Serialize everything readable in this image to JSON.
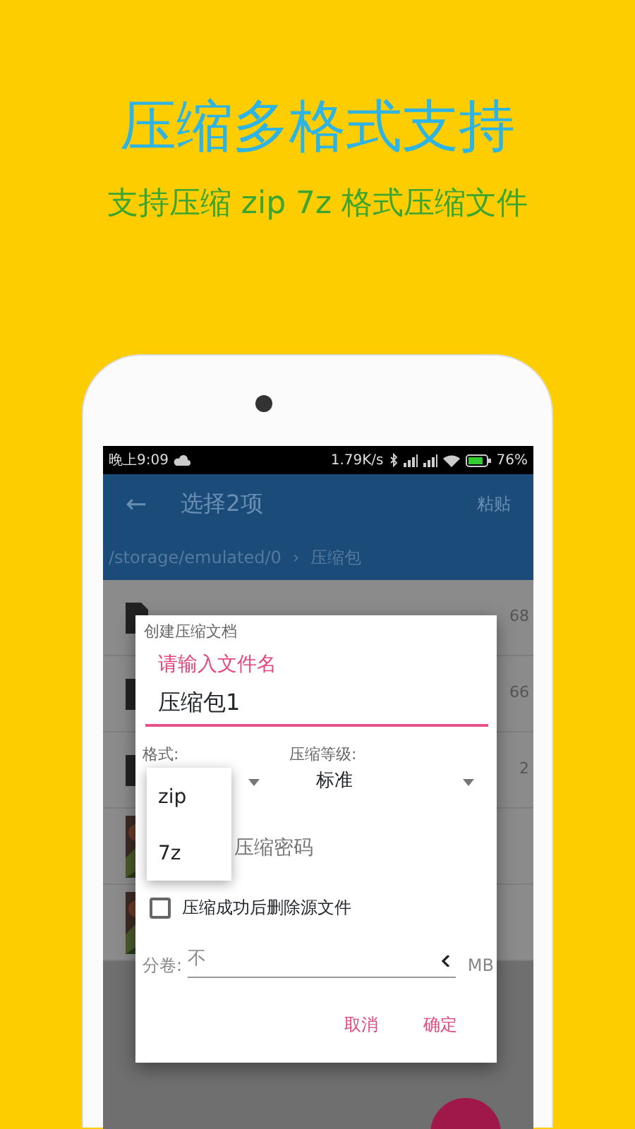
{
  "promo": {
    "title": "压缩多格式支持",
    "subtitle": "支持压缩 zip 7z 格式压缩文件"
  },
  "status_bar": {
    "time": "晚上9:09",
    "speed": "1.79K/s",
    "battery": "76%"
  },
  "app_bar": {
    "back": "←",
    "title": "选择2项",
    "action": "粘贴"
  },
  "breadcrumb": {
    "path": "/storage/emulated/0",
    "separator": "›",
    "folder": "压缩包"
  },
  "files": [
    {
      "kind": "document",
      "size": "68"
    },
    {
      "kind": "document",
      "size": "66"
    },
    {
      "kind": "document",
      "size": "2"
    },
    {
      "kind": "picture"
    },
    {
      "kind": "picture"
    }
  ],
  "dialog": {
    "title": "创建压缩文档",
    "name_label": "请输入文件名",
    "name_value": "压缩包1",
    "format_label": "格式:",
    "level_label": "压缩等级:",
    "level_value": "标准",
    "password_placeholder": "压缩密码",
    "delete_source": {
      "label": "压缩成功后删除源文件",
      "checked": false
    },
    "split_label": "分卷:",
    "split_value": "不",
    "split_unit": "MB",
    "buttons": [
      "取消",
      "确定"
    ]
  },
  "format_menu": [
    {
      "label": "zip"
    },
    {
      "label": "7z"
    }
  ]
}
